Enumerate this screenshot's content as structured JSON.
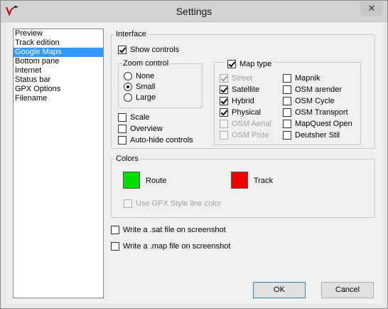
{
  "window": {
    "title": "Settings",
    "close_glyph": "✕"
  },
  "nav": {
    "items": [
      {
        "label": "Preview"
      },
      {
        "label": "Track edition"
      },
      {
        "label": "Google Maps"
      },
      {
        "label": "Bottom pane"
      },
      {
        "label": "Internet"
      },
      {
        "label": "Status bar"
      },
      {
        "label": "GPX Options"
      },
      {
        "label": "Filename"
      }
    ],
    "selected_index": 2
  },
  "interface": {
    "legend": "Interface",
    "show_controls": {
      "label": "Show controls",
      "checked": true
    },
    "zoom": {
      "legend": "Zoom control",
      "options": [
        {
          "label": "None",
          "checked": false
        },
        {
          "label": "Small",
          "checked": true
        },
        {
          "label": "Large",
          "checked": false
        }
      ]
    },
    "scale": {
      "label": "Scale",
      "checked": false
    },
    "overview": {
      "label": "Overview",
      "checked": false
    },
    "autohide": {
      "label": "Auto-hide controls",
      "checked": false
    },
    "map_type": {
      "label": "Map type",
      "checked": true,
      "left": [
        {
          "label": "Street",
          "checked": true,
          "disabled": true
        },
        {
          "label": "Satellite",
          "checked": true,
          "disabled": false
        },
        {
          "label": "Hybrid",
          "checked": true,
          "disabled": false
        },
        {
          "label": "Physical",
          "checked": true,
          "disabled": false
        },
        {
          "label": "OSM Aerial",
          "checked": false,
          "disabled": true
        },
        {
          "label": "OSM Piste",
          "checked": false,
          "disabled": true
        }
      ],
      "right": [
        {
          "label": "Mapnik",
          "checked": false,
          "disabled": false
        },
        {
          "label": "OSM arender",
          "checked": false,
          "disabled": false
        },
        {
          "label": "OSM Cycle",
          "checked": false,
          "disabled": false
        },
        {
          "label": "OSM Transport",
          "checked": false,
          "disabled": false
        },
        {
          "label": "MapQuest Open",
          "checked": false,
          "disabled": false
        },
        {
          "label": "Deutsher Stil",
          "checked": false,
          "disabled": false
        }
      ]
    }
  },
  "colors": {
    "legend": "Colors",
    "route": {
      "label": "Route",
      "color": "#00dd00"
    },
    "track": {
      "label": "Track",
      "color": "#ee0000"
    },
    "gpx_style": {
      "label": "Use GPX Style line color",
      "checked": false,
      "disabled": true
    }
  },
  "screenshot": {
    "sat": {
      "label": "Write a .sat file on screenshot",
      "checked": false
    },
    "map": {
      "label": "Write a .map file on screenshot",
      "checked": false
    }
  },
  "buttons": {
    "ok": "OK",
    "cancel": "Cancel"
  }
}
